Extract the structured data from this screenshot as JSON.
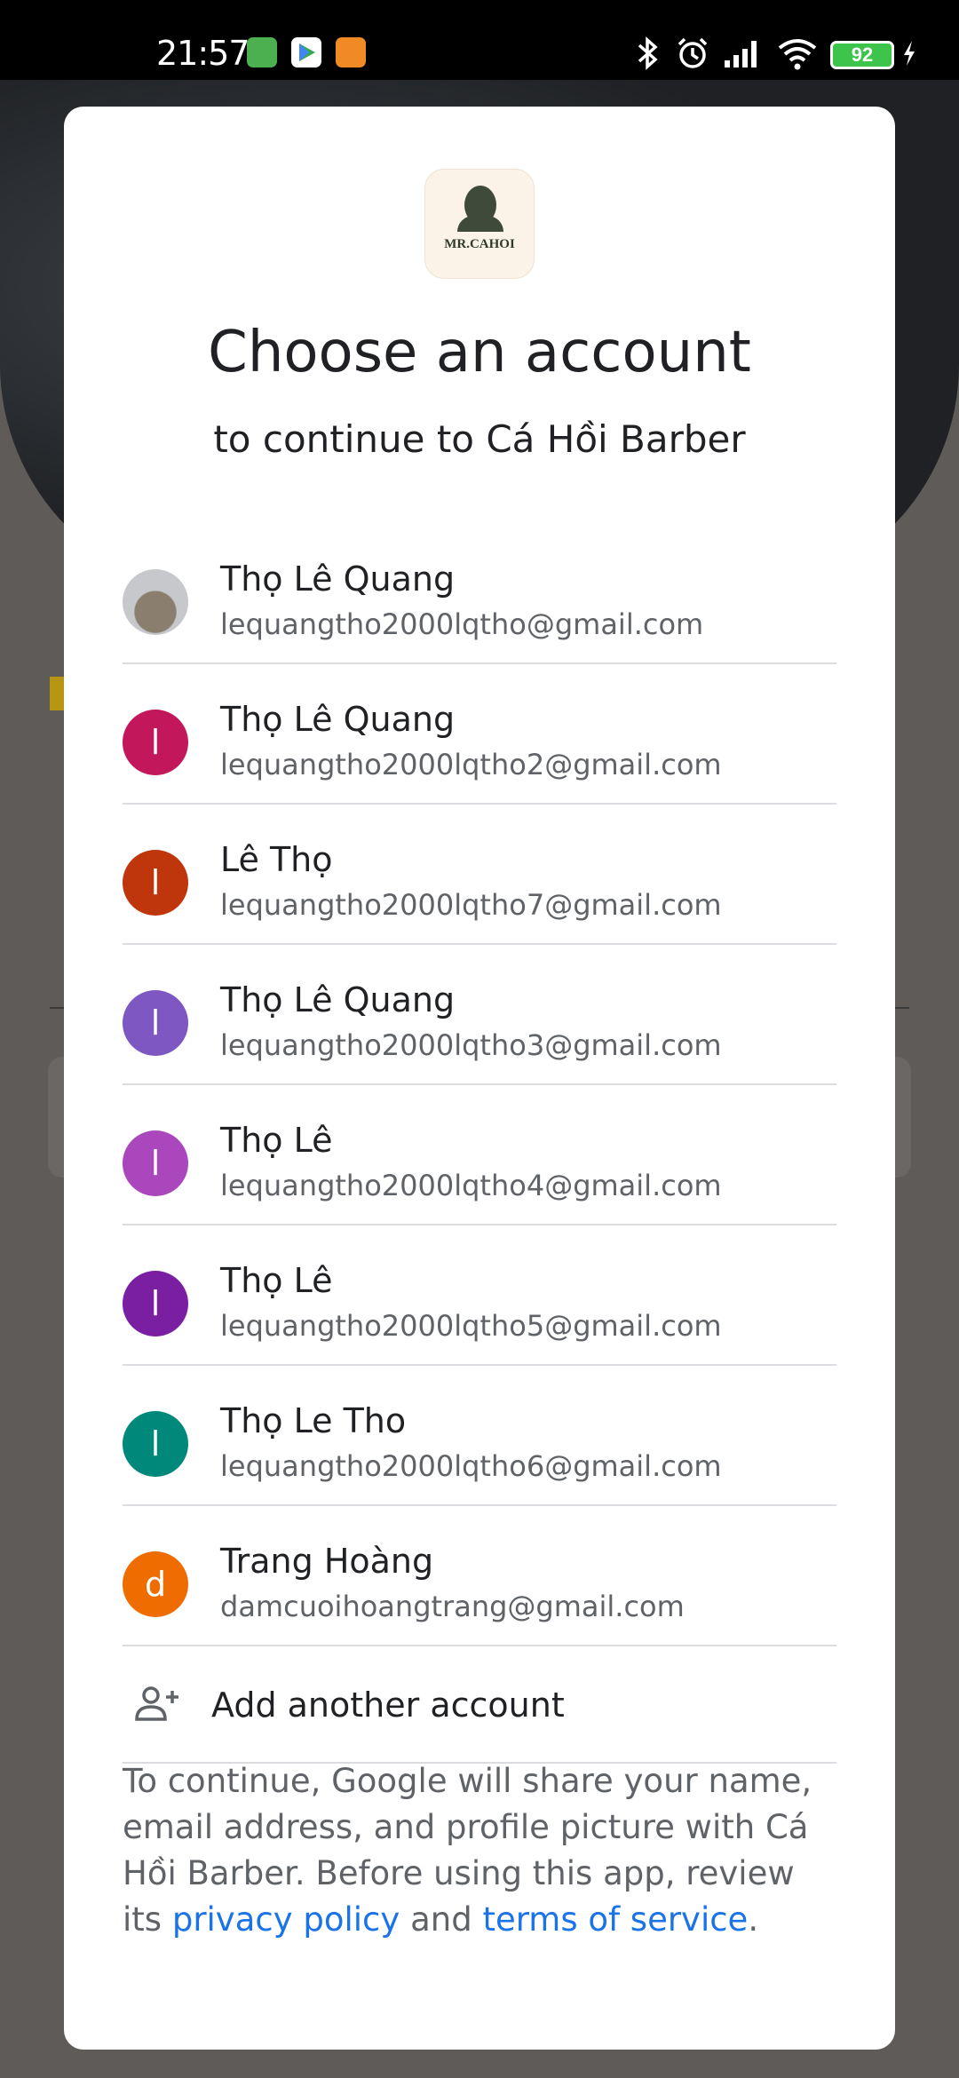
{
  "status_bar": {
    "time": "21:57",
    "battery": "92",
    "icons": [
      "bluetooth-icon",
      "alarm-icon",
      "signal-icon",
      "wifi-icon",
      "charging-icon"
    ]
  },
  "dialog": {
    "logo_text": "MR.CAHOI",
    "title": "Choose an account",
    "subtitle": "to continue to Cá Hồi Barber",
    "accounts": [
      {
        "name": "Thọ Lê Quang",
        "email": "lequangtho2000lqtho@gmail.com",
        "initial": "",
        "color": "#9aa0a6"
      },
      {
        "name": "Thọ Lê Quang",
        "email": "lequangtho2000lqtho2@gmail.com",
        "initial": "l",
        "color": "#c2185b"
      },
      {
        "name": "Lê Thọ",
        "email": "lequangtho2000lqtho7@gmail.com",
        "initial": "l",
        "color": "#bf360c"
      },
      {
        "name": "Thọ Lê Quang",
        "email": "lequangtho2000lqtho3@gmail.com",
        "initial": "l",
        "color": "#7e57c2"
      },
      {
        "name": "Thọ Lê",
        "email": "lequangtho2000lqtho4@gmail.com",
        "initial": "l",
        "color": "#ab47bc"
      },
      {
        "name": "Thọ Lê",
        "email": "lequangtho2000lqtho5@gmail.com",
        "initial": "l",
        "color": "#7b1fa2"
      },
      {
        "name": "Thọ Le Tho",
        "email": "lequangtho2000lqtho6@gmail.com",
        "initial": "l",
        "color": "#00897b"
      },
      {
        "name": "Trang Hoàng",
        "email": "damcuoihoangtrang@gmail.com",
        "initial": "d",
        "color": "#ef6c00"
      }
    ],
    "add_account_label": "Add another account",
    "disclaimer": {
      "text_1": "To continue, Google will share your name, email address, and profile picture with Cá Hồi Barber. Before using this app, review its ",
      "privacy_link": "privacy policy",
      "text_2": " and ",
      "terms_link": "terms of service",
      "text_3": "."
    }
  }
}
